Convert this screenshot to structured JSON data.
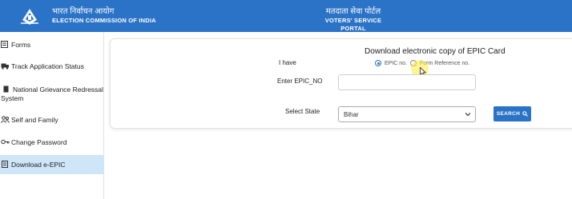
{
  "header": {
    "brand_hindi": "भारत निर्वाचन आयोग",
    "brand_english": "ELECTION COMMISSION OF INDIA",
    "portal_hindi": "मतदाता सेवा पोर्टल",
    "portal_english": "VOTERS' SERVICE PORTAL",
    "color": "#2b73c6"
  },
  "sidebar": {
    "items": [
      {
        "label": "Forms",
        "icon": "form-icon"
      },
      {
        "label": "Track Application Status",
        "icon": "truck-icon"
      },
      {
        "label_line1": "National Grievance Redressal",
        "label_line2": "System",
        "icon": "document-icon"
      },
      {
        "label": "Self and Family",
        "icon": "people-icon"
      },
      {
        "label": "Change Password",
        "icon": "key-icon"
      },
      {
        "label": "Download e-EPIC",
        "icon": "document-icon",
        "active": true
      }
    ]
  },
  "form": {
    "title": "Download electronic copy of EPIC Card",
    "i_have_label": "I have",
    "radio_options": [
      {
        "label": "EPIC no.",
        "checked": true
      },
      {
        "label": "Form Reference no.",
        "checked": false
      }
    ],
    "epic_label": "Enter EPIC_NO",
    "epic_value": "",
    "state_label": "Select State",
    "state_selected": "Bihar",
    "search_label": "SEARCH"
  }
}
